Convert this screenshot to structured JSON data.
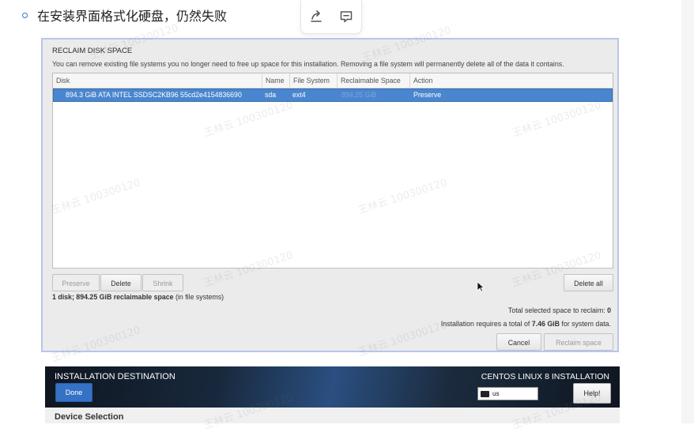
{
  "post": {
    "bullet_text": "在安装界面格式化硬盘，仍然失败"
  },
  "toolbar": {
    "share_icon": "share-icon",
    "comment_icon": "comment-icon"
  },
  "watermark": "王林云 100300120",
  "dialog": {
    "title": "RECLAIM DISK SPACE",
    "description": "You can remove existing file systems you no longer need to free up space for this installation.  Removing a file system will permanently delete all of the data it contains.",
    "columns": [
      "Disk",
      "Name",
      "File System",
      "Reclaimable Space",
      "Action"
    ],
    "rows": [
      {
        "disk": "894.3 GiB ATA INTEL SSDSC2KB96 55cd2e4154836690",
        "name": "sda",
        "file_system": "ext4",
        "reclaimable": "894.25 GiB",
        "action": "Preserve"
      }
    ],
    "buttons": {
      "preserve": "Preserve",
      "delete": "Delete",
      "shrink": "Shrink",
      "delete_all": "Delete all",
      "cancel": "Cancel",
      "reclaim": "Reclaim space"
    },
    "summary_bold": "1 disk; 894.25 GiB reclaimable space",
    "summary_rest": " (in file systems)",
    "total_label": "Total selected space to reclaim: ",
    "total_value": "0",
    "requires_prefix": "Installation requires a total of ",
    "requires_value": "7.46 GiB",
    "requires_suffix": " for system data."
  },
  "installer": {
    "title": "INSTALLATION DESTINATION",
    "done": "Done",
    "product": "CENTOS LINUX 8 INSTALLATION",
    "keyboard_layout": "us",
    "help": "Help!",
    "section": "Device Selection"
  },
  "colors": {
    "selection": "#4a86cf",
    "done_button": "#3572c6",
    "bullet": "#3b6fd8"
  }
}
